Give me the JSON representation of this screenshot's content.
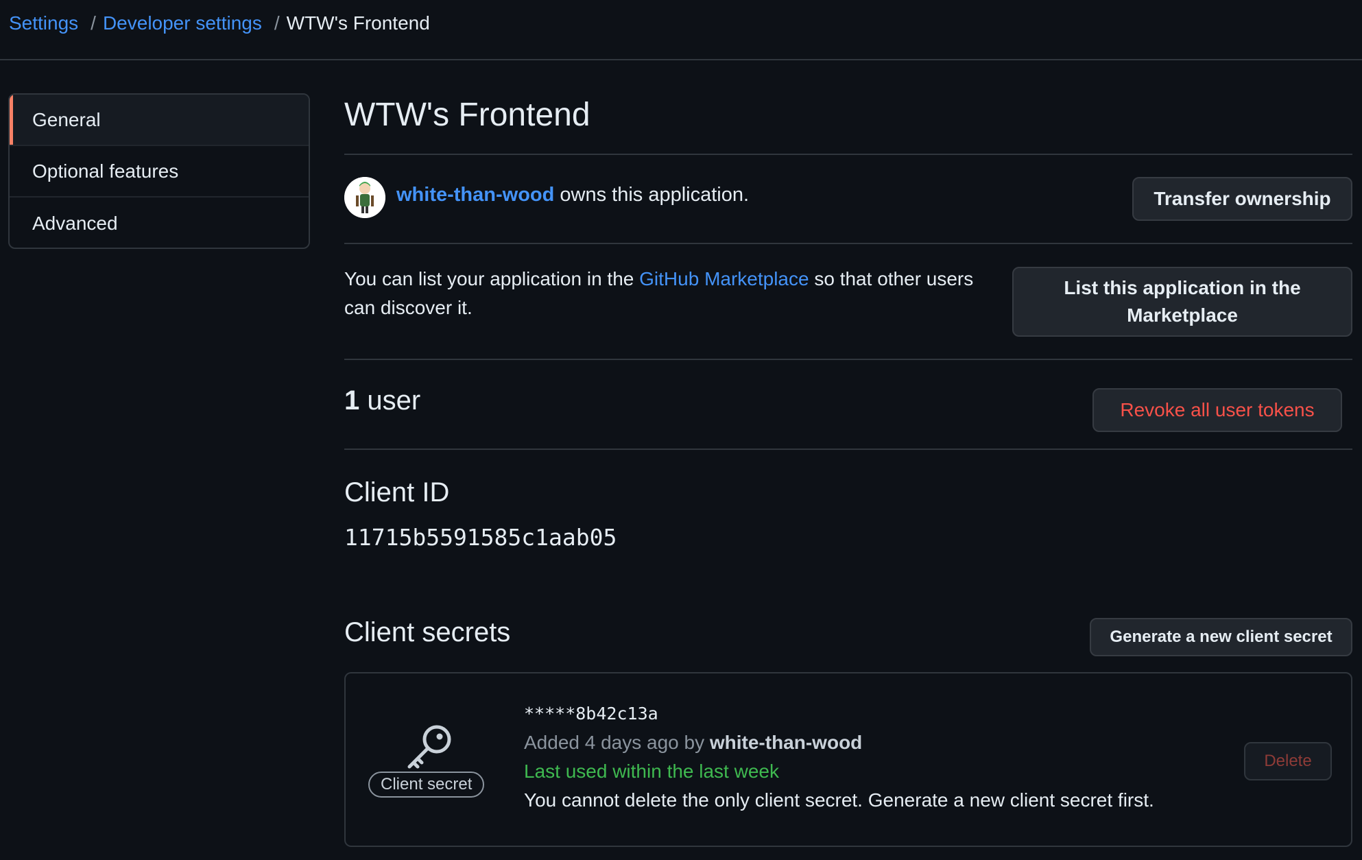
{
  "breadcrumb": {
    "settings": "Settings",
    "developer_settings": "Developer settings",
    "current": "WTW's Frontend",
    "separator": "/"
  },
  "sidebar": {
    "items": [
      {
        "label": "General",
        "active": true
      },
      {
        "label": "Optional features",
        "active": false
      },
      {
        "label": "Advanced",
        "active": false
      }
    ]
  },
  "app": {
    "title": "WTW's Frontend",
    "owner": "white-than-wood",
    "owner_suffix": " owns this application.",
    "transfer_button": "Transfer ownership"
  },
  "marketplace": {
    "text_before": "You can list your application in the ",
    "link": "GitHub Marketplace",
    "text_after": " so that other users can discover it.",
    "button": "List this application in the Marketplace"
  },
  "users": {
    "count": "1",
    "label": " user",
    "revoke_button": "Revoke all user tokens"
  },
  "client_id": {
    "heading": "Client ID",
    "value": "11715b5591585c1aab05"
  },
  "client_secrets": {
    "heading": "Client secrets",
    "generate_button": "Generate a new client secret",
    "secret": {
      "badge": "Client secret",
      "masked_value": "*****8b42c13a",
      "added_prefix": "Added 4 days ago by ",
      "added_by": "white-than-wood",
      "last_used": "Last used within the last week",
      "warning": "You cannot delete the only client secret. Generate a new client secret first.",
      "delete_button": "Delete"
    }
  },
  "colors": {
    "background": "#0d1117",
    "link": "#4493f8",
    "active_indicator": "#f78166",
    "danger": "#f85149",
    "success": "#3fb950"
  },
  "icons": [
    "avatar",
    "key-icon"
  ]
}
